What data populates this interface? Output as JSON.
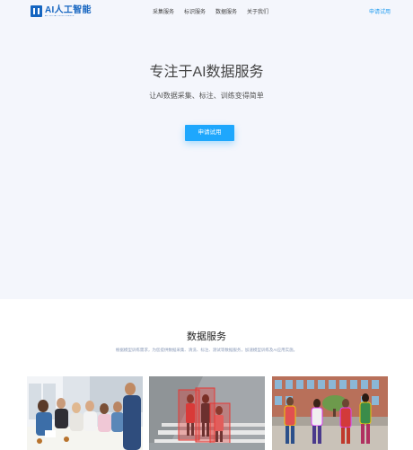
{
  "header": {
    "logo_name": "AI人工智能",
    "logo_tagline": "ARTIFICIAL INTELLIGENCE",
    "nav_items": [
      "采集服务",
      "标识服务",
      "数据服务",
      "关于我们"
    ],
    "cta_label": "申请试用"
  },
  "hero": {
    "title": "专注于AI数据服务",
    "subtitle": "让AI数据采集、标注、训练变得简单",
    "button_label": "申请试用"
  },
  "services": {
    "title": "数据服务",
    "description": "根据模型训练需求，为您提供数据采集、清洗、标注、测试等数据服务，加速模型训练及AI应用实施。"
  },
  "colors": {
    "accent": "#1ea7fd",
    "brand": "#1565c0",
    "hero_background": "#f4f6fc"
  }
}
